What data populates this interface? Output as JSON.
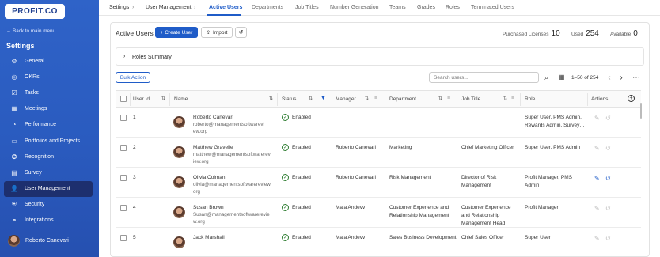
{
  "sidebar": {
    "logo": "PROFIT.CO",
    "back_link": "← Back to main menu",
    "heading": "Settings",
    "items": [
      {
        "label": "General",
        "icon": "gear-icon"
      },
      {
        "label": "OKRs",
        "icon": "target-icon"
      },
      {
        "label": "Tasks",
        "icon": "checklist-icon"
      },
      {
        "label": "Meetings",
        "icon": "calendar-icon"
      },
      {
        "label": "Performance",
        "icon": "chart-icon"
      },
      {
        "label": "Portfolios and Projects",
        "icon": "folder-icon"
      },
      {
        "label": "Recognition",
        "icon": "trophy-icon"
      },
      {
        "label": "Survey",
        "icon": "survey-icon"
      },
      {
        "label": "User Management",
        "icon": "user-icon",
        "active": true
      },
      {
        "label": "Security",
        "icon": "shield-icon"
      },
      {
        "label": "Integrations",
        "icon": "link-icon"
      }
    ],
    "user_name": "Roberto Canevari"
  },
  "breadcrumbs": [
    "Settings",
    "User Management"
  ],
  "tabs": [
    "Active Users",
    "Departments",
    "Job Titles",
    "Number Generation",
    "Teams",
    "Grades",
    "Roles",
    "Terminated Users"
  ],
  "panel": {
    "title": "Active Users",
    "create_label": "+ Create User",
    "import_label": "Import",
    "purchased_label": "Purchased Licenses",
    "purchased_value": "10",
    "used_label": "Used",
    "used_value": "254",
    "available_label": "Available",
    "available_value": "0",
    "roles_summary": "Roles Summary",
    "bulk_action": "Bulk Action",
    "search_placeholder": "Search users...",
    "pager_text": "1–50 of 254"
  },
  "table": {
    "columns": [
      "User Id",
      "Name",
      "Status",
      "Manager",
      "Department",
      "Job Title",
      "Role",
      "Actions"
    ],
    "rows": [
      {
        "id": "1",
        "name": "Roberto Canevari",
        "email_l1": "roberto@managementsoftwarevi",
        "email_l2": "ew.org",
        "status": "Enabled",
        "manager": "",
        "department": "",
        "department_l2": "",
        "job_l1": "",
        "job_l2": "",
        "job_l3": "",
        "role_l1": "Super User, PMS Admin,",
        "role_l2": "Rewards Admin, Survey…"
      },
      {
        "id": "2",
        "name": "Matthew Gravelle",
        "email_l1": "matthew@managementsoftwarerev",
        "email_l2": "iew.org",
        "status": "Enabled",
        "manager": "Roberto Canevari",
        "department": "Marketing",
        "department_l2": "",
        "job_l1": "Chief Marketing Officer",
        "job_l2": "",
        "job_l3": "",
        "role_l1": "Super User, PMS Admin",
        "role_l2": ""
      },
      {
        "id": "3",
        "name": "Olivia Colman",
        "email_l1": "olivia@managementsoftwarereview.",
        "email_l2": "org",
        "status": "Enabled",
        "manager": "Roberto Canevari",
        "department": "Risk Management",
        "department_l2": "",
        "job_l1": "Director of Risk",
        "job_l2": "Management",
        "job_l3": "",
        "role_l1": "Profit Manager, PMS",
        "role_l2": "Admin"
      },
      {
        "id": "4",
        "name": "Susan Brown",
        "email_l1": "Susan@managementsoftwarerevie",
        "email_l2": "w.org",
        "status": "Enabled",
        "manager": "Maja Andevv",
        "department": "Customer Experience and",
        "department_l2": "Relationship Management",
        "job_l1": "Customer Experience",
        "job_l2": "and Relationship",
        "job_l3": "Management Head",
        "role_l1": "Profit Manager",
        "role_l2": ""
      },
      {
        "id": "5",
        "name": "Jack Marshall",
        "email_l1": "",
        "email_l2": "",
        "status": "Enabled",
        "manager": "Maja Andevv",
        "department": "Sales Business Development",
        "department_l2": "",
        "job_l1": "Chief Sales Officer",
        "job_l2": "",
        "job_l3": "",
        "role_l1": "Super User",
        "role_l2": ""
      }
    ]
  },
  "colors": {
    "accent": "#1f5cc8",
    "sidebar": "#2a5bbf",
    "active_nav": "#1d2f6e",
    "enabled": "#2e7d32"
  }
}
